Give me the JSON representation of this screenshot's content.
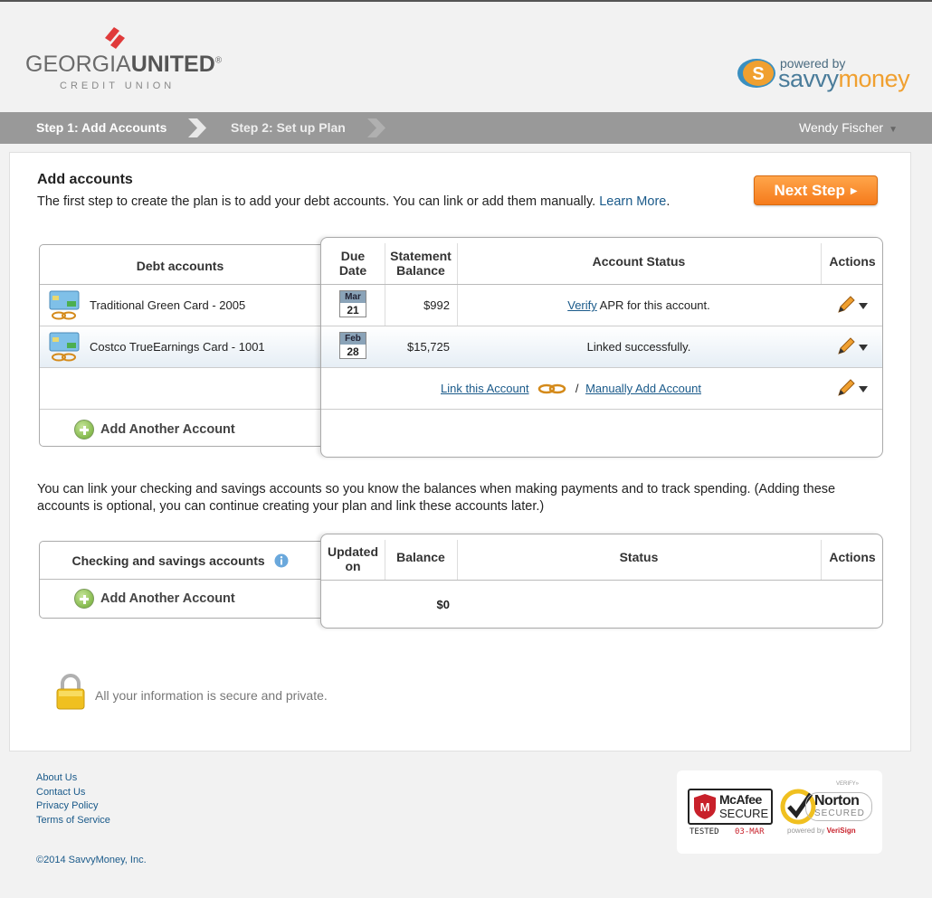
{
  "brand": {
    "name_part1": "GEORGIA",
    "name_part2": "UNITED",
    "registered": "®",
    "subtitle": "CREDIT UNION"
  },
  "partner": {
    "powered_by": "powered by",
    "name_part1": "savvy",
    "name_part2": "money"
  },
  "nav": {
    "step1": "Step 1: Add Accounts",
    "step2": "Step 2: Set up Plan",
    "user": "Wendy Fischer",
    "user_caret": "▼"
  },
  "page": {
    "title": "Add accounts",
    "intro": "The first step to create the plan is to add your debt accounts. You can link or add them manually.",
    "learn_more": "Learn More",
    "intro_end": ".",
    "next_button": "Next Step",
    "next_button_arrow": "▶"
  },
  "debt_table": {
    "header_left": "Debt accounts",
    "header_due": "Due Date",
    "header_balance": "Statement Balance",
    "header_status": "Account Status",
    "header_actions": "Actions",
    "rows": [
      {
        "name": "Traditional Green Card - 2005",
        "due_month": "Mar",
        "due_day": "21",
        "balance": "$992",
        "status_link": "Verify",
        "status_text": " APR for this account."
      },
      {
        "name": "Costco TrueEarnings Card - 1001",
        "due_month": "Feb",
        "due_day": "28",
        "balance": "$15,725",
        "status_text": "Linked successfully."
      }
    ],
    "link_account": "Link this Account",
    "separator": "/",
    "manual_add": "Manually Add Account",
    "add_another": "Add Another Account"
  },
  "checking": {
    "paragraph": "You can link your checking and savings accounts so you know the balances when making payments and to track spending. (Adding these accounts is optional, you can continue creating your plan and link these accounts later.)",
    "header_left": "Checking and savings accounts",
    "header_updated": "Updated on",
    "header_balance": "Balance",
    "header_status": "Status",
    "header_actions": "Actions",
    "balance": "$0",
    "add_another": "Add Another Account"
  },
  "security": {
    "text": "All your information is secure and private."
  },
  "footer": {
    "links": [
      "About Us",
      "Contact Us",
      "Privacy Policy",
      "Terms of Service"
    ],
    "copyright": "©2014 SavvyMoney, Inc."
  },
  "badges": {
    "mcafee_name": "McAfee",
    "mcafee_secure": "SECURE",
    "mcafee_tested": "TESTED",
    "mcafee_date": "03-MAR",
    "norton_verify": "VERIFY»",
    "norton_name": "Norton",
    "norton_secured": "SECURED",
    "norton_powered": "powered by",
    "norton_verisign": "VeriSign"
  },
  "colors": {
    "accent_orange": "#f57b1c",
    "link_blue": "#1a5a8a",
    "nav_gray": "#999999",
    "brand_red": "#e03a3a"
  }
}
